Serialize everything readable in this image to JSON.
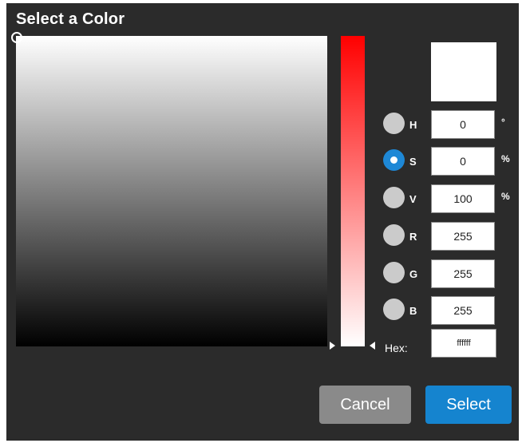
{
  "dialog": {
    "title": "Select a Color"
  },
  "channels": [
    {
      "label": "H",
      "value": "0",
      "unit": "°",
      "selected": false
    },
    {
      "label": "S",
      "value": "0",
      "unit": "%",
      "selected": true
    },
    {
      "label": "V",
      "value": "100",
      "unit": "%",
      "selected": false
    },
    {
      "label": "R",
      "value": "255",
      "unit": "",
      "selected": false
    },
    {
      "label": "G",
      "value": "255",
      "unit": "",
      "selected": false
    },
    {
      "label": "B",
      "value": "255",
      "unit": "",
      "selected": false
    }
  ],
  "hex": {
    "label": "Hex:",
    "value": "ffffff"
  },
  "buttons": {
    "cancel": "Cancel",
    "select": "Select"
  },
  "colors": {
    "dialog_bg": "#2b2b2b",
    "preview": "#ffffff",
    "accent": "#1584cf",
    "cancel_bg": "#8a8a8a"
  }
}
